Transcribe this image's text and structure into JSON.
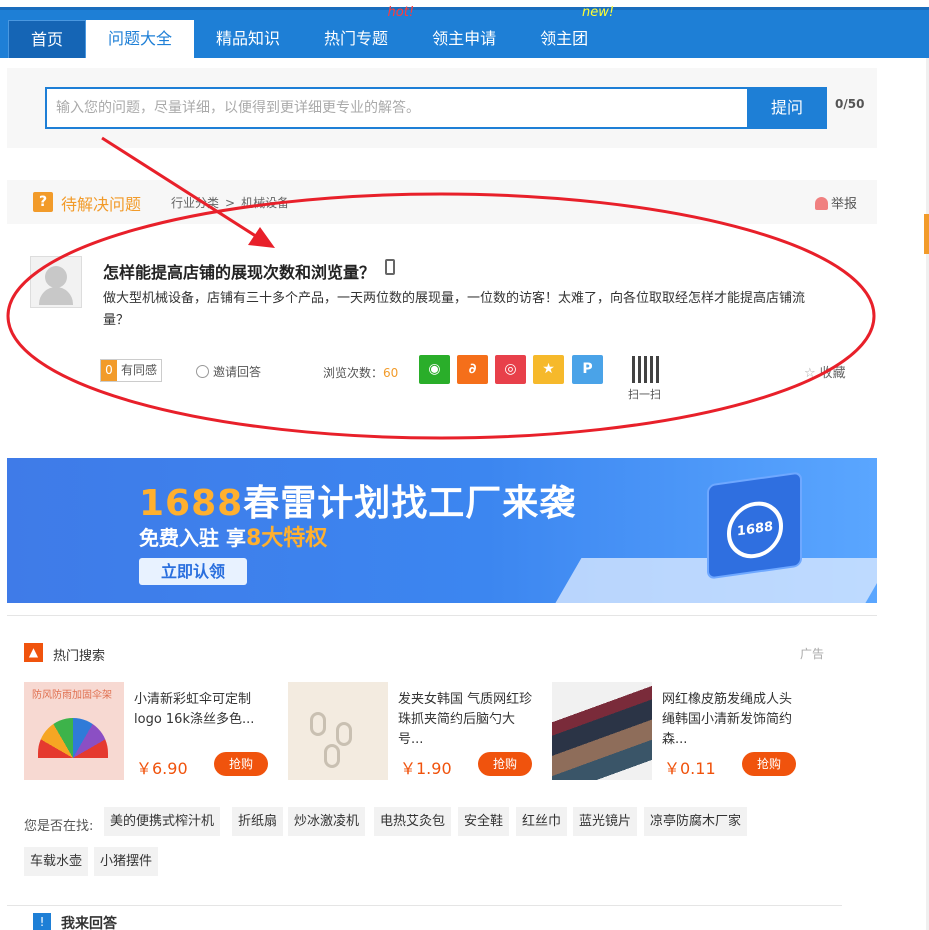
{
  "nav": {
    "items": [
      {
        "label": "首页"
      },
      {
        "label": "问题大全"
      },
      {
        "label": "精品知识"
      },
      {
        "label": "热门专题",
        "tag": "hot!"
      },
      {
        "label": "领主申请"
      },
      {
        "label": "领主团",
        "tag": "new!"
      }
    ]
  },
  "ask": {
    "placeholder": "输入您的问题，尽量详细，以便得到更详细更专业的解答。",
    "button": "提问",
    "count": "0/50"
  },
  "pending": {
    "icon": "?",
    "title": "待解决问题",
    "breadcrumb": [
      "行业分类",
      ">",
      "机械设备"
    ],
    "report": "举报"
  },
  "question": {
    "title": "怎样能提高店铺的展现次数和浏览量？",
    "description": "做大型机械设备，店铺有三十多个产品，一天两位数的展现量，一位数的访客！太难了，向各位取取经怎样才能提高店铺流量？",
    "same_count": "0",
    "same_label": "有同感",
    "invite": "邀请回答",
    "views_label": "浏览次数：",
    "views": "60",
    "scan": "扫一扫",
    "favorite": "收藏",
    "share_icons": [
      "wechat-icon",
      "alibaba-icon",
      "weibo-icon",
      "qzone-icon",
      "pengyou-icon"
    ]
  },
  "banner": {
    "title_num": "1688",
    "title_rest": "春雷计划找工厂来袭",
    "sub_pre": "免费入驻 享",
    "sub_hl": "8大特权",
    "button": "立即认领",
    "badge": "1688"
  },
  "hot_search": {
    "title": "热门搜索",
    "ad": "广告",
    "products": [
      {
        "name": "小清新彩虹伞可定制logo 16k涤丝多色...",
        "price": "￥6.90",
        "buy": "抢购",
        "img_text": "防风防雨加固伞架"
      },
      {
        "name": "发夹女韩国 气质网红珍珠抓夹简约后脑勺大号...",
        "price": "￥1.90",
        "buy": "抢购"
      },
      {
        "name": "网红橡皮筋发绳成人头绳韩国小清新发饰简约森...",
        "price": "￥0.11",
        "buy": "抢购"
      }
    ]
  },
  "looking_for": {
    "label": "您是否在找:",
    "tags": [
      "美的便携式榨汁机",
      "折纸扇",
      "炒冰激凌机",
      "电热艾灸包",
      "安全鞋",
      "红丝巾",
      "蓝光镜片",
      "凉亭防腐木厂家",
      "车载水壶",
      "小猪摆件"
    ]
  },
  "answer": {
    "title": "我来回答"
  },
  "colors": {
    "nav_blue": "#1e7fd6",
    "accent_orange": "#f29b2a",
    "buy_orange": "#f0530d",
    "annotation_red": "#e8202a"
  }
}
